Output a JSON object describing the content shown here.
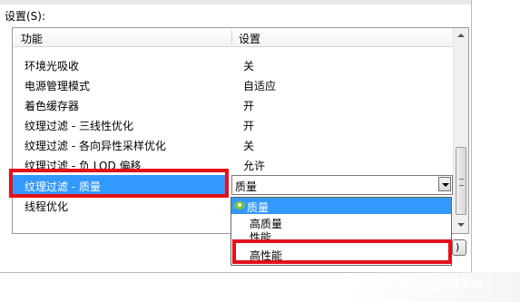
{
  "window": {
    "settings_label": "设置(S):"
  },
  "list": {
    "col_feature": "功能",
    "col_setting": "设置",
    "rows": [
      {
        "name": "环境光吸收",
        "value": "关"
      },
      {
        "name": "电源管理模式",
        "value": "自适应"
      },
      {
        "name": "着色缓存器",
        "value": "开"
      },
      {
        "name": "纹理过滤 - 三线性优化",
        "value": "开"
      },
      {
        "name": "纹理过滤 - 各向异性采样优化",
        "value": "关"
      },
      {
        "name": "纹理过滤 - 负 LOD 偏移",
        "value": "允许"
      },
      {
        "name": "纹理过滤 - 质量",
        "value": "质量"
      },
      {
        "name": "线程优化",
        "value": ""
      }
    ]
  },
  "dropdown": {
    "options": [
      "质量",
      "高质量",
      "性能",
      "高性能"
    ],
    "selected": "质量",
    "highlight_color": "#3399ff",
    "icon": "nvidia-icon"
  },
  "annotation": {
    "color": "#e50f1a"
  },
  "button": {
    "partial_label": ")"
  },
  "watermark": {
    "text": "百度号/小白一键重装系统"
  }
}
